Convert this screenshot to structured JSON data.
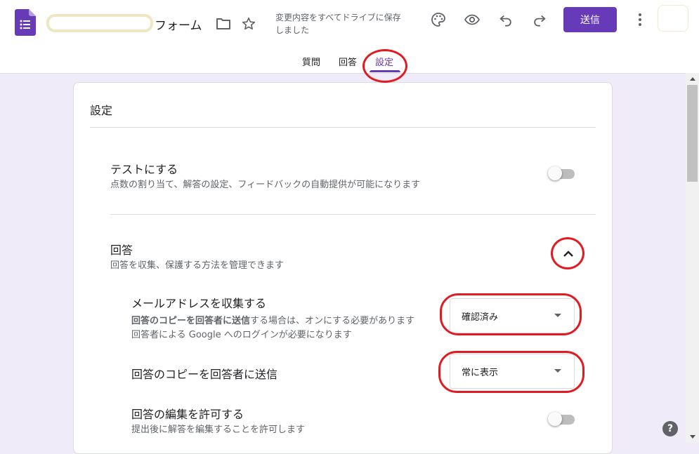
{
  "header": {
    "form_title": "フォーム",
    "save_status": "変更内容をすべてドライブに保存しました",
    "send_label": "送信"
  },
  "tabs": [
    {
      "label": "質問"
    },
    {
      "label": "回答"
    },
    {
      "label": "設定",
      "active": true
    }
  ],
  "settings": {
    "title": "設定",
    "quiz": {
      "title": "テストにする",
      "description": "点数の割り当て、解答の設定、フィードバックの自動提供が可能になります",
      "enabled": false
    },
    "responses": {
      "title": "回答",
      "description": "回答を収集、保護する方法を管理できます",
      "expanded": true,
      "collect_email": {
        "title": "メールアドレスを収集する",
        "desc_bold": "回答のコピーを回答者に送信",
        "desc_rest": "する場合は、オンにする必要があります",
        "desc_line2": "回答者による Google へのログインが必要になります",
        "selected": "確認済み"
      },
      "send_copy": {
        "title": "回答のコピーを回答者に送信",
        "selected": "常に表示"
      },
      "allow_edit": {
        "title": "回答の編集を許可する",
        "description": "提出後に解答を編集することを許可します",
        "enabled": false
      }
    }
  },
  "help_label": "?",
  "colors": {
    "accent": "#673ab7",
    "annotation": "#e11b22",
    "background": "#f0ebf8"
  }
}
